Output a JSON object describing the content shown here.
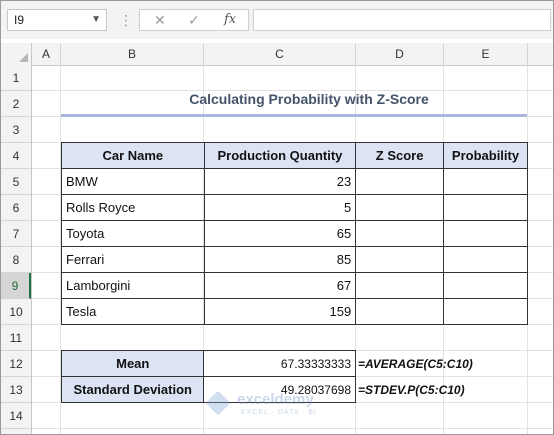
{
  "formula_bar": {
    "name_box": "I9",
    "cancel_icon": "✕",
    "enter_icon": "✓",
    "fx_label": "fx",
    "formula": ""
  },
  "columns": [
    "A",
    "B",
    "C",
    "D",
    "E"
  ],
  "rows": [
    "1",
    "2",
    "3",
    "4",
    "5",
    "6",
    "7",
    "8",
    "9",
    "10",
    "11",
    "12",
    "13",
    "14"
  ],
  "title": "Calculating Probability with Z-Score",
  "table": {
    "headers": [
      "Car Name",
      "Production Quantity",
      "Z Score",
      "Probability"
    ],
    "rows": [
      {
        "name": "BMW",
        "qty": "23",
        "z": "",
        "p": ""
      },
      {
        "name": "Rolls Royce",
        "qty": "5",
        "z": "",
        "p": ""
      },
      {
        "name": "Toyota",
        "qty": "65",
        "z": "",
        "p": ""
      },
      {
        "name": "Ferrari",
        "qty": "85",
        "z": "",
        "p": ""
      },
      {
        "name": "Lamborgini",
        "qty": "67",
        "z": "",
        "p": ""
      },
      {
        "name": "Tesla",
        "qty": "159",
        "z": "",
        "p": ""
      }
    ]
  },
  "stats": {
    "mean_label": "Mean",
    "mean_value": "67.33333333",
    "mean_formula": "=AVERAGE(C5:C10)",
    "sd_label": "Standard Deviation",
    "sd_value": "49.28037698",
    "sd_formula": "=STDEV.P(C5:C10)"
  },
  "watermark": {
    "name": "exceldemy",
    "tagline": "EXCEL · DATA · BI"
  },
  "colors": {
    "header_fill": "#dce4f4",
    "title_color": "#44546a",
    "accent_rule": "#aab6dc",
    "selection": "#217346"
  }
}
